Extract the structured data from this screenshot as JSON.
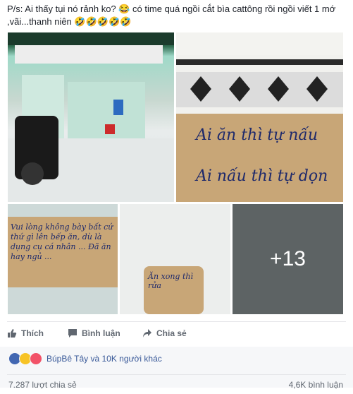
{
  "post": {
    "caption": "P/s: Ai thấy tụi nó rảnh ko? 😂 có time quá ngồi cắt bìa cattông rồi ngồi viết 1 mớ ,vãi...thanh niên 🤣🤣🤣🤣🤣"
  },
  "photos": {
    "p2_line1": "Ai ăn thì tự nấu",
    "p2_line2": "Ai nấu thì tự dọn",
    "p3_text": "Vui lòng không bày bất cứ thứ gì lên bếp ăn, dù là dụng cụ cá nhân ... Đã ăn hay ngủ ...",
    "p4_text": "Ăn xong thì rửa",
    "more_count": "+13"
  },
  "actions": {
    "like": "Thích",
    "comment": "Bình luận",
    "share": "Chia sẻ"
  },
  "reactions": {
    "summary": "BúpBê Tây và 10K người khác"
  },
  "stats": {
    "shares": "7.287 lượt chia sẻ",
    "comments": "4,6K bình luận"
  },
  "colors": {
    "link": "#385898",
    "like_blue": "#4267b2",
    "muted": "#606770"
  }
}
